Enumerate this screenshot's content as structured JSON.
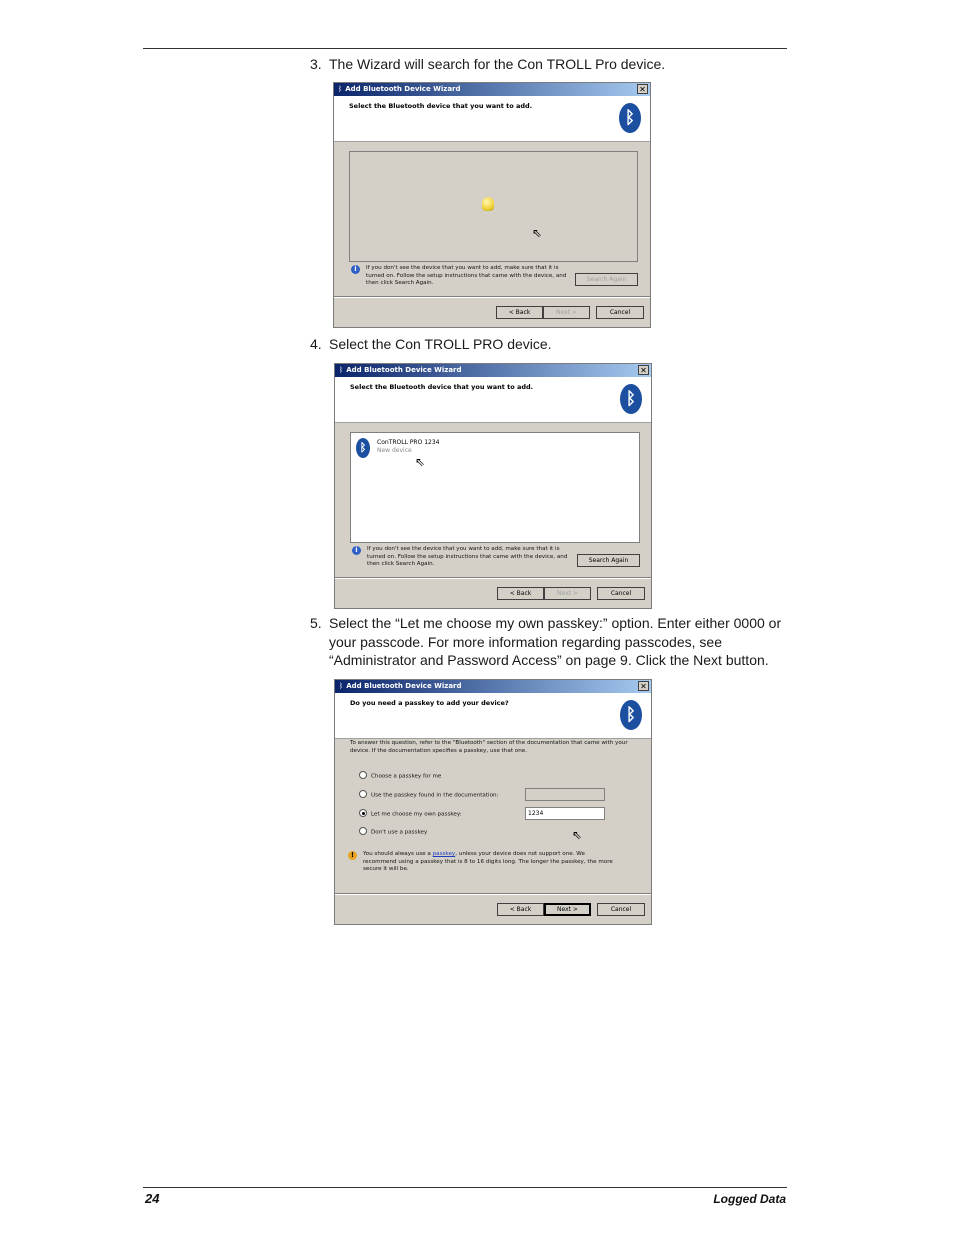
{
  "steps": [
    {
      "num": "3.",
      "text": "The Wizard will search for the Con TROLL Pro device."
    },
    {
      "num": "4.",
      "text": "Select the Con TROLL PRO device."
    },
    {
      "num": "5.",
      "text": "Select the “Let me choose my own passkey:” option. Enter either 0000 or your passcode. For more information regarding passcodes, see “Administrator and Password Access” on page 9. Click the Next button."
    }
  ],
  "wizard1": {
    "title": "Add Bluetooth Device Wizard",
    "heading": "Select the Bluetooth device that you want to add.",
    "info": "If you don't see the device that you want to add, make sure that it is turned on. Follow the setup instructions that came with the device, and then click Search Again.",
    "search_again": "Search Again",
    "back": "< Back",
    "next": "Next >",
    "cancel": "Cancel"
  },
  "wizard2": {
    "title": "Add Bluetooth Device Wizard",
    "heading": "Select the Bluetooth device that you want to add.",
    "device_name": "ConTROLL PRO 1234",
    "device_status": "New device",
    "info": "If you don't see the device that you want to add, make sure that it is turned on. Follow the setup instructions that came with the device, and then click Search Again.",
    "search_again": "Search Again",
    "back": "< Back",
    "next": "Next >",
    "cancel": "Cancel"
  },
  "wizard3": {
    "title": "Add Bluetooth Device Wizard",
    "heading": "Do you need a passkey to add your device?",
    "description": "To answer this question, refer to the \"Bluetooth\" section of the documentation that came with your device. If the documentation specifies a passkey, use that one.",
    "options": [
      {
        "label": "Choose a passkey for me",
        "selected": false
      },
      {
        "label": "Use the passkey found in the documentation:",
        "selected": false
      },
      {
        "label": "Let me choose my own passkey:",
        "selected": true
      },
      {
        "label": "Don't use a passkey",
        "selected": false
      }
    ],
    "passkey_value": "1234",
    "warning_before": "You should always use a ",
    "warning_link": "passkey",
    "warning_after": ", unless your device does not support one. We recommend using a passkey that is 8 to 16 digits long. The longer the passkey, the more secure it will be.",
    "back": "< Back",
    "next": "Next >",
    "cancel": "Cancel"
  },
  "footer": {
    "page_number": "24",
    "section_title": "Logged Data"
  }
}
